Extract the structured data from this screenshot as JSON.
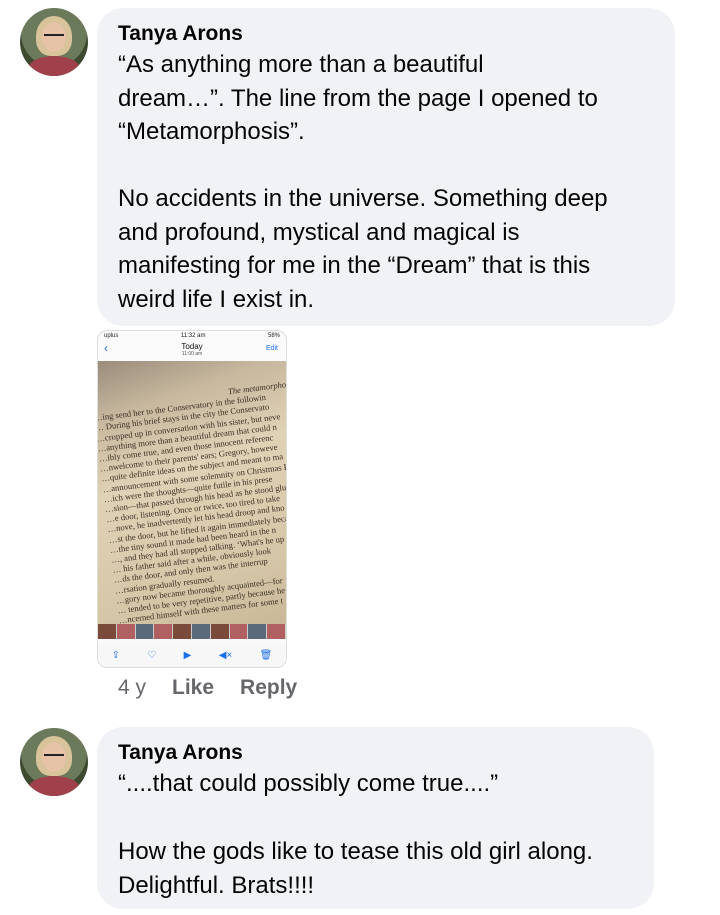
{
  "comments": [
    {
      "author": "Tanya Arons",
      "paragraphs": [
        "“As anything more than a beautiful\ndream…”. The line from the page I opened to\n“Metamorphosis”.",
        "No accidents in the universe.  Something deep\nand profound, mystical and magical is\nmanifesting for me in the “Dream” that is this\nweird life I exist in."
      ],
      "age": "4 y",
      "like_label": "Like",
      "reply_label": "Reply"
    },
    {
      "author": "Tanya Arons",
      "paragraphs": [
        "“....that could possibly come true....”",
        "How the gods like to tease this old girl along.\nDelightful.  Brats!!!!"
      ]
    }
  ],
  "attached_screenshot": {
    "status_left": "uplus",
    "status_time": "11:32 am",
    "status_battery": "58%",
    "title": "Today",
    "subtitle": "11:00 am",
    "edit_label": "Edit",
    "page_header": "The metamorphosis",
    "page_lines": [
      "…ing send her to the Conservatory in the followin",
      "… During his brief stays in the city the Conservato",
      "…cropped up in conversation with his sister, but neve",
      "…anything more than a beautiful dream that could n",
      "…ibly come true, and even those innocent referenc",
      "…nwelcome to their parents' ears; Gregory, howeve",
      "…quite definite ideas on the subject and meant to ma",
      "…announcement with some solemnity on Christmas Ev",
      "…ich were the thoughts—quite futile in his prese",
      "…sion—that passed through his head as he stood glu",
      "…e door, listening. Once or twice, too tired to take",
      "…nove, he inadvertently let his head droop and kno",
      "…st the door, but he lifted it again immediately beca",
      "…the tiny sound it made had been heard in the n",
      "…, and they had all stopped talking. ‘What's he up",
      "… his father said after a while, obviously look",
      "…ds the door, and only then was the interrup",
      "…rsation gradually resumed.",
      "…gory now became thoroughly acquainted—for",
      "… tended to be very repetitive, partly because he",
      "…ncerned himself with these matters for some t"
    ],
    "toolbar_icons": [
      "share-icon",
      "heart-icon",
      "play-icon",
      "mute-icon",
      "trash-icon"
    ]
  }
}
